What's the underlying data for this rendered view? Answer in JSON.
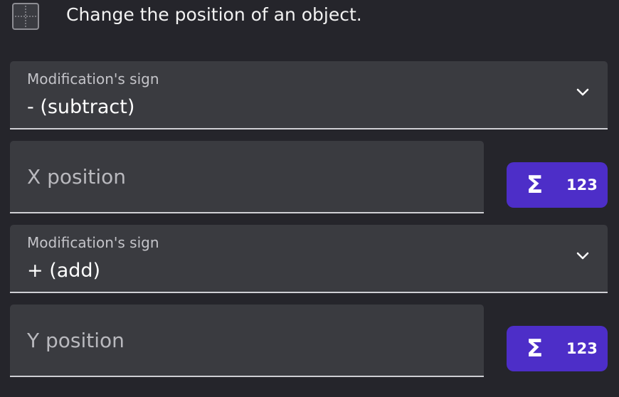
{
  "header": {
    "icon": "position-grid-icon",
    "description": "Change the position of an object."
  },
  "x_sign": {
    "label": "Modification's sign",
    "value": "- (subtract)"
  },
  "x_field": {
    "placeholder": "X position",
    "value": ""
  },
  "x_expr_button": {
    "icon": "sigma-icon",
    "label": "123"
  },
  "y_sign": {
    "label": "Modification's sign",
    "value": "+ (add)"
  },
  "y_field": {
    "placeholder": "Y position",
    "value": ""
  },
  "y_expr_button": {
    "icon": "sigma-icon",
    "label": "123"
  },
  "colors": {
    "background": "#25252b",
    "field_background": "#3a3b40",
    "accent": "#4d2ec8",
    "underline": "#cfcfd4"
  }
}
